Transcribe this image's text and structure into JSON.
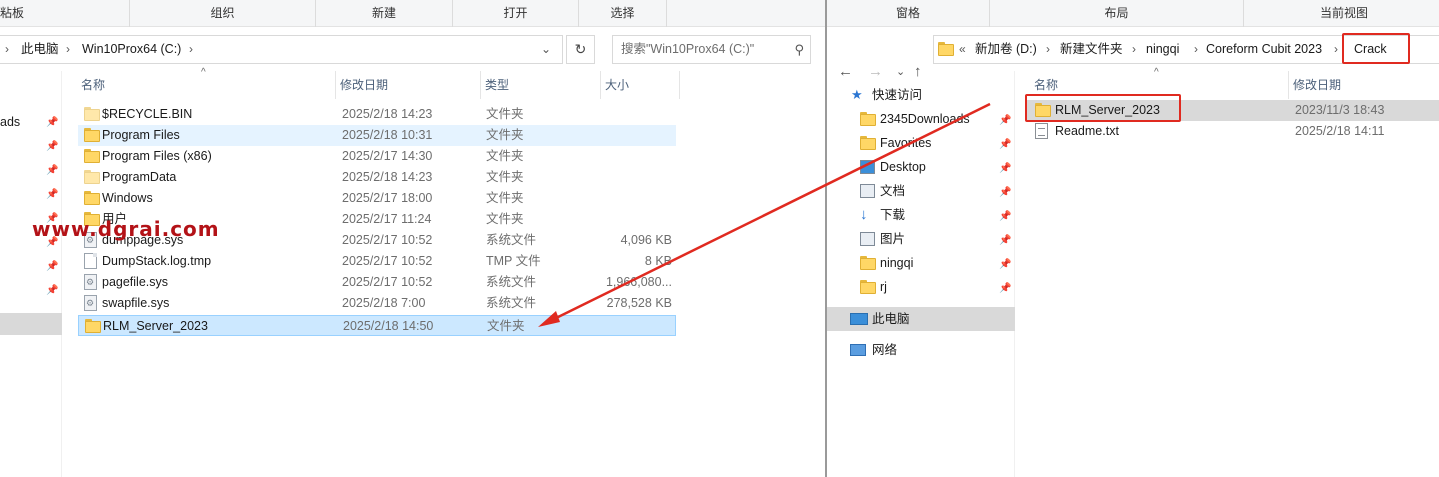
{
  "left": {
    "ribbon": [
      "粘板",
      "组织",
      "新建",
      "打开",
      "选择"
    ],
    "address": {
      "crumbs": [
        "此电脑",
        "Win10Prox64 (C:)"
      ]
    },
    "search": {
      "placeholder": "搜索\"Win10Prox64 (C:)\""
    },
    "sidebar_partial": [
      "ads"
    ],
    "columns": {
      "name": "名称",
      "modified": "修改日期",
      "type": "类型",
      "size": "大小"
    },
    "files": [
      {
        "name": "$RECYCLE.BIN",
        "date": "2025/2/18 14:23",
        "type": "文件夹",
        "size": "",
        "icon": "folder-pale-icon"
      },
      {
        "name": "Program Files",
        "date": "2025/2/18 10:31",
        "type": "文件夹",
        "size": "",
        "icon": "folder-icon"
      },
      {
        "name": "Program Files (x86)",
        "date": "2025/2/17 14:30",
        "type": "文件夹",
        "size": "",
        "icon": "folder-icon"
      },
      {
        "name": "ProgramData",
        "date": "2025/2/18 14:23",
        "type": "文件夹",
        "size": "",
        "icon": "folder-pale-icon"
      },
      {
        "name": "Windows",
        "date": "2025/2/17 18:00",
        "type": "文件夹",
        "size": "",
        "icon": "folder-icon"
      },
      {
        "name": "用户",
        "date": "2025/2/17 11:24",
        "type": "文件夹",
        "size": "",
        "icon": "folder-icon"
      },
      {
        "name": "dumppage.sys",
        "date": "2025/2/17 10:52",
        "type": "系统文件",
        "size": "4,096 KB",
        "icon": "system-file-icon"
      },
      {
        "name": "DumpStack.log.tmp",
        "date": "2025/2/17 10:52",
        "type": "TMP 文件",
        "size": "8 KB",
        "icon": "file-icon"
      },
      {
        "name": "pagefile.sys",
        "date": "2025/2/17 10:52",
        "type": "系统文件",
        "size": "1,966,080...",
        "icon": "system-file-icon"
      },
      {
        "name": "swapfile.sys",
        "date": "2025/2/18 7:00",
        "type": "系统文件",
        "size": "278,528 KB",
        "icon": "system-file-icon"
      },
      {
        "name": "RLM_Server_2023",
        "date": "2025/2/18 14:50",
        "type": "文件夹",
        "size": "",
        "icon": "folder-icon"
      }
    ]
  },
  "right": {
    "ribbon": [
      "窗格",
      "布局",
      "当前视图"
    ],
    "address": {
      "crumbs": [
        "新加卷 (D:)",
        "新建文件夹",
        "ningqi",
        "Coreform Cubit 2023",
        "Crack"
      ],
      "overflow": "«"
    },
    "nav": {
      "quick_access": "快速访问",
      "items": [
        "2345Downloads",
        "Favorites",
        "Desktop",
        "文档",
        "下载",
        "图片",
        "ningqi",
        "rj"
      ],
      "this_pc": "此电脑",
      "network": "网络"
    },
    "columns": {
      "name": "名称",
      "modified": "修改日期"
    },
    "files": [
      {
        "name": "RLM_Server_2023",
        "date": "2023/11/3 18:43",
        "icon": "folder-icon"
      },
      {
        "name": "Readme.txt",
        "date": "2025/2/18 14:11",
        "icon": "text-file-icon"
      }
    ]
  },
  "watermark": "www.dgrai.com",
  "colors": {
    "highlight": "#e02a20",
    "selection": "#cce8ff",
    "hover": "#e5f3ff"
  }
}
